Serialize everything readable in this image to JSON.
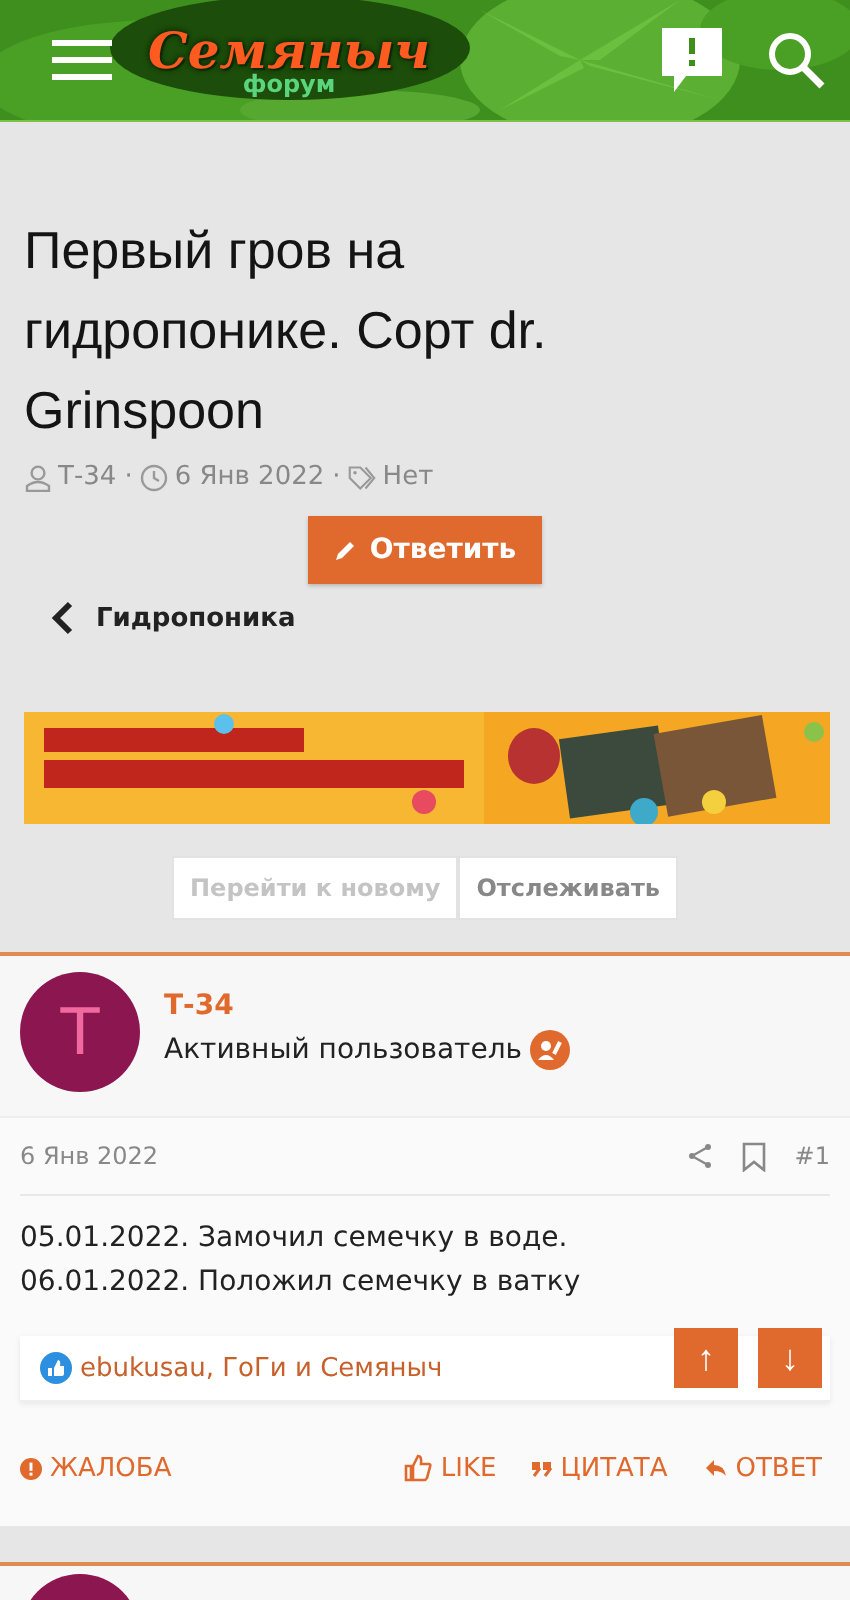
{
  "header": {
    "logo": "Семяныч",
    "logo_sub": "форум"
  },
  "thread": {
    "title": "Первый гров на гидропонике. Сорт dr. Grinspoon",
    "author": "Т-34",
    "date": "6 Янв 2022",
    "tags": "Нет",
    "separators": [
      "·",
      "·"
    ]
  },
  "reply_button": "Ответить",
  "breadcrumb": "Гидропоника",
  "thread_buttons": [
    {
      "label": "Перейти к новому",
      "disabled": true
    },
    {
      "label": "Отслеживать",
      "disabled": false
    }
  ],
  "post": {
    "avatar_letter": "Т",
    "username": "Т-34",
    "user_title": "Активный пользователь",
    "date": "6 Янв 2022",
    "number": "#1",
    "lines": [
      "05.01.2022. Замочил семечку в воде.",
      "06.01.2022. Положил семечку в ватку"
    ],
    "reactions": "ebukusau, ГоГи и Семяныч",
    "actions": [
      {
        "kind": "report",
        "label": "ЖАЛОБА"
      },
      {
        "kind": "like",
        "label": "LIKE"
      },
      {
        "kind": "quote",
        "label": "ЦИТАТА"
      },
      {
        "kind": "reply",
        "label": "ОТВЕТ"
      }
    ]
  },
  "scroll_buttons": [
    "↑",
    "↓"
  ]
}
